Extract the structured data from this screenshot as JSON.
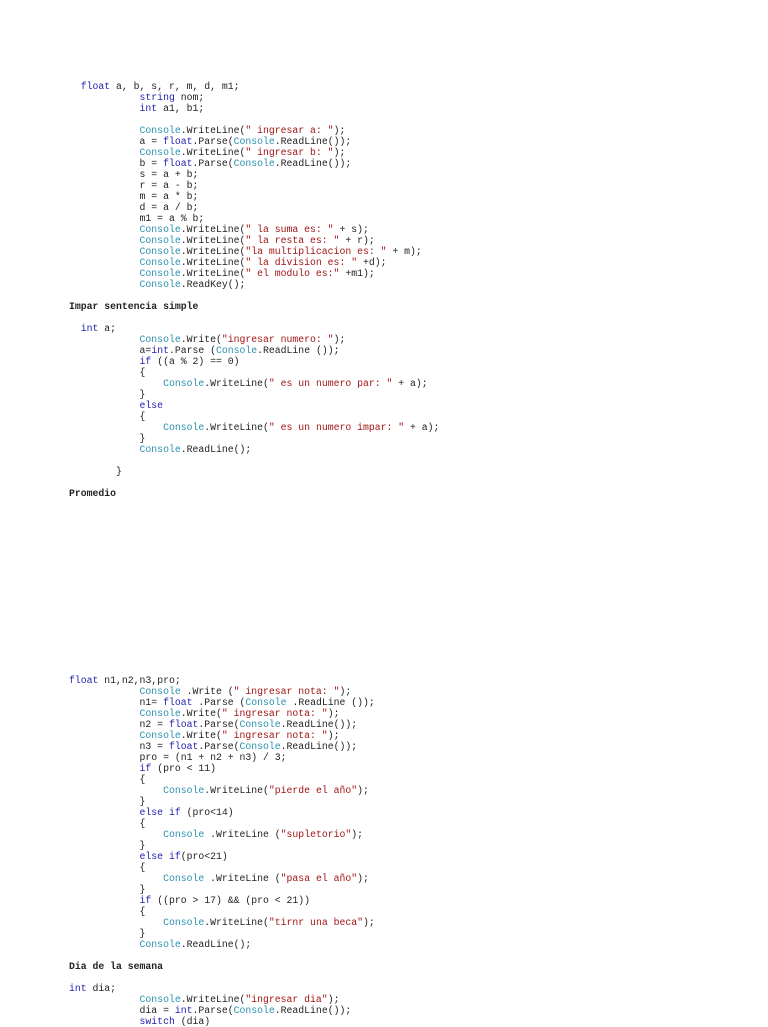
{
  "colors": {
    "keyword": "#1f1fb0",
    "class": "#2b91af",
    "string": "#a31515",
    "text": "#222222"
  },
  "lines": [
    [
      [
        "k",
        "  float"
      ],
      [
        "p",
        " a, b, s, r, m, d, m1;"
      ]
    ],
    [
      [
        "k",
        "            string"
      ],
      [
        "p",
        " nom;"
      ]
    ],
    [
      [
        "k",
        "            int"
      ],
      [
        "p",
        " a1, b1;"
      ]
    ],
    [],
    [
      [
        "c",
        "            Console"
      ],
      [
        "p",
        ".WriteLine("
      ],
      [
        "s",
        "\" ingresar a: \""
      ],
      [
        "p",
        ");"
      ]
    ],
    [
      [
        "p",
        "            a = "
      ],
      [
        "k",
        "float"
      ],
      [
        "p",
        ".Parse("
      ],
      [
        "c",
        "Console"
      ],
      [
        "p",
        ".ReadLine());"
      ]
    ],
    [
      [
        "c",
        "            Console"
      ],
      [
        "p",
        ".WriteLine("
      ],
      [
        "s",
        "\" ingresar b: \""
      ],
      [
        "p",
        ");"
      ]
    ],
    [
      [
        "p",
        "            b = "
      ],
      [
        "k",
        "float"
      ],
      [
        "p",
        ".Parse("
      ],
      [
        "c",
        "Console"
      ],
      [
        "p",
        ".ReadLine());"
      ]
    ],
    [
      [
        "p",
        "            s = a + b;"
      ]
    ],
    [
      [
        "p",
        "            r = a - b;"
      ]
    ],
    [
      [
        "p",
        "            m = a * b;"
      ]
    ],
    [
      [
        "p",
        "            d = a / b;"
      ]
    ],
    [
      [
        "p",
        "            m1 = a % b;"
      ]
    ],
    [
      [
        "c",
        "            Console"
      ],
      [
        "p",
        ".WriteLine("
      ],
      [
        "s",
        "\" la suma es: \""
      ],
      [
        "p",
        " + s);"
      ]
    ],
    [
      [
        "c",
        "            Console"
      ],
      [
        "p",
        ".WriteLine("
      ],
      [
        "s",
        "\" la resta es: \""
      ],
      [
        "p",
        " + r);"
      ]
    ],
    [
      [
        "c",
        "            Console"
      ],
      [
        "p",
        ".WriteLine("
      ],
      [
        "s",
        "\"la multiplicacion es: \""
      ],
      [
        "p",
        " + m);"
      ]
    ],
    [
      [
        "c",
        "            Console"
      ],
      [
        "p",
        ".WriteLine("
      ],
      [
        "s",
        "\" la division es: \""
      ],
      [
        "p",
        " +d);"
      ]
    ],
    [
      [
        "c",
        "            Console"
      ],
      [
        "p",
        ".WriteLine("
      ],
      [
        "s",
        "\" el modulo es:\""
      ],
      [
        "p",
        " +m1);"
      ]
    ],
    [
      [
        "c",
        "            Console"
      ],
      [
        "p",
        ".ReadKey();"
      ]
    ],
    [],
    [
      [
        "h",
        "Impar sentencia simple"
      ]
    ],
    [],
    [
      [
        "k",
        "  int"
      ],
      [
        "p",
        " a;"
      ]
    ],
    [
      [
        "c",
        "            Console"
      ],
      [
        "p",
        ".Write("
      ],
      [
        "s",
        "\"ingresar numero: \""
      ],
      [
        "p",
        ");"
      ]
    ],
    [
      [
        "p",
        "            a="
      ],
      [
        "k",
        "int"
      ],
      [
        "p",
        ".Parse ("
      ],
      [
        "c",
        "Console"
      ],
      [
        "p",
        ".ReadLine ());"
      ]
    ],
    [
      [
        "k",
        "            if"
      ],
      [
        "p",
        " ((a % 2) == 0)"
      ]
    ],
    [
      [
        "p",
        "            {"
      ]
    ],
    [
      [
        "c",
        "                Console"
      ],
      [
        "p",
        ".WriteLine("
      ],
      [
        "s",
        "\" es un numero par: \""
      ],
      [
        "p",
        " + a);"
      ]
    ],
    [
      [
        "p",
        "            }"
      ]
    ],
    [
      [
        "k",
        "            else"
      ]
    ],
    [
      [
        "p",
        "            {"
      ]
    ],
    [
      [
        "c",
        "                Console"
      ],
      [
        "p",
        ".WriteLine("
      ],
      [
        "s",
        "\" es un numero impar: \""
      ],
      [
        "p",
        " + a);"
      ]
    ],
    [
      [
        "p",
        "            }"
      ]
    ],
    [
      [
        "c",
        "            Console"
      ],
      [
        "p",
        ".ReadLine();"
      ]
    ],
    [],
    [
      [
        "p",
        "        }"
      ]
    ],
    [],
    [
      [
        "h",
        "Promedio"
      ]
    ],
    [],
    [],
    [],
    [],
    [],
    [],
    [],
    [],
    [],
    [],
    [],
    [],
    [],
    [],
    [],
    [],
    [
      [
        "k",
        "float"
      ],
      [
        "p",
        " n1,n2,n3,pro;"
      ]
    ],
    [
      [
        "c",
        "            Console"
      ],
      [
        "p",
        " .Write ("
      ],
      [
        "s",
        "\" ingresar nota: \""
      ],
      [
        "p",
        ");"
      ]
    ],
    [
      [
        "p",
        "            n1= "
      ],
      [
        "k",
        "float"
      ],
      [
        "p",
        " .Parse ("
      ],
      [
        "c",
        "Console"
      ],
      [
        "p",
        " .ReadLine ());"
      ]
    ],
    [
      [
        "c",
        "            Console"
      ],
      [
        "p",
        ".Write("
      ],
      [
        "s",
        "\" ingresar nota: \""
      ],
      [
        "p",
        ");"
      ]
    ],
    [
      [
        "p",
        "            n2 = "
      ],
      [
        "k",
        "float"
      ],
      [
        "p",
        ".Parse("
      ],
      [
        "c",
        "Console"
      ],
      [
        "p",
        ".ReadLine());"
      ]
    ],
    [
      [
        "c",
        "            Console"
      ],
      [
        "p",
        ".Write("
      ],
      [
        "s",
        "\" ingresar nota: \""
      ],
      [
        "p",
        ");"
      ]
    ],
    [
      [
        "p",
        "            n3 = "
      ],
      [
        "k",
        "float"
      ],
      [
        "p",
        ".Parse("
      ],
      [
        "c",
        "Console"
      ],
      [
        "p",
        ".ReadLine());"
      ]
    ],
    [
      [
        "p",
        "            pro = (n1 + n2 + n3) / 3;"
      ]
    ],
    [
      [
        "k",
        "            if"
      ],
      [
        "p",
        " (pro < 11)"
      ]
    ],
    [
      [
        "p",
        "            {"
      ]
    ],
    [
      [
        "c",
        "                Console"
      ],
      [
        "p",
        ".WriteLine("
      ],
      [
        "s",
        "\"pierde el año\""
      ],
      [
        "p",
        ");"
      ]
    ],
    [
      [
        "p",
        "            }"
      ]
    ],
    [
      [
        "k",
        "            else if"
      ],
      [
        "p",
        " (pro<14)"
      ]
    ],
    [
      [
        "p",
        "            {"
      ]
    ],
    [
      [
        "c",
        "                Console"
      ],
      [
        "p",
        " .WriteLine ("
      ],
      [
        "s",
        "\"supletorio\""
      ],
      [
        "p",
        ");"
      ]
    ],
    [
      [
        "p",
        "            }"
      ]
    ],
    [
      [
        "k",
        "            else if"
      ],
      [
        "p",
        "(pro<21)"
      ]
    ],
    [
      [
        "p",
        "            {"
      ]
    ],
    [
      [
        "c",
        "                Console"
      ],
      [
        "p",
        " .WriteLine ("
      ],
      [
        "s",
        "\"pasa el año\""
      ],
      [
        "p",
        ");"
      ]
    ],
    [
      [
        "p",
        "            }"
      ]
    ],
    [
      [
        "k",
        "            if"
      ],
      [
        "p",
        " ((pro > 17) && (pro < 21))"
      ]
    ],
    [
      [
        "p",
        "            {"
      ]
    ],
    [
      [
        "c",
        "                Console"
      ],
      [
        "p",
        ".WriteLine("
      ],
      [
        "s",
        "\"tirnr una beca\""
      ],
      [
        "p",
        ");"
      ]
    ],
    [
      [
        "p",
        "            }"
      ]
    ],
    [
      [
        "c",
        "            Console"
      ],
      [
        "p",
        ".ReadLine();"
      ]
    ],
    [],
    [
      [
        "h",
        "Dia de la semana"
      ]
    ],
    [],
    [
      [
        "k",
        "int"
      ],
      [
        "p",
        " dia;"
      ]
    ],
    [
      [
        "c",
        "            Console"
      ],
      [
        "p",
        ".WriteLine("
      ],
      [
        "s",
        "\"ingresar dia\""
      ],
      [
        "p",
        ");"
      ]
    ],
    [
      [
        "p",
        "            dia = "
      ],
      [
        "k",
        "int"
      ],
      [
        "p",
        ".Parse("
      ],
      [
        "c",
        "Console"
      ],
      [
        "p",
        ".ReadLine());"
      ]
    ],
    [
      [
        "k",
        "            switch"
      ],
      [
        "p",
        " (dia)"
      ]
    ]
  ]
}
